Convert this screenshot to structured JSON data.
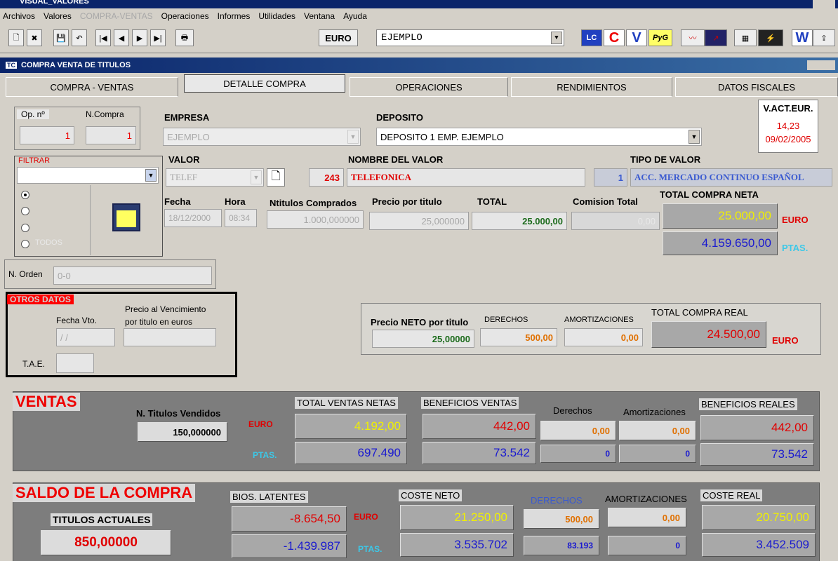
{
  "window": {
    "title": "VISUAL_VALORES"
  },
  "menu": [
    "Archivos",
    "Valores",
    "COMPRA-VENTAS",
    "Operaciones",
    "Informes",
    "Utilidades",
    "Ventana",
    "Ayuda"
  ],
  "toolbar": {
    "currency_button": "EURO",
    "company_select": "EJEMPLO",
    "icon_c": "C",
    "icon_v": "V",
    "icon_pyg": "PyG",
    "icon_w": "W"
  },
  "inner_window": {
    "title": "COMPRA VENTA DE TITULOS"
  },
  "tabs": [
    "COMPRA - VENTAS",
    "DETALLE COMPRA",
    "OPERACIONES",
    "RENDIMIENTOS",
    "DATOS FISCALES"
  ],
  "header": {
    "op_label": "Op. nº",
    "op_value": "1",
    "ncompra_label": "N.Compra",
    "ncompra_value": "1",
    "empresa_label": "EMPRESA",
    "empresa_value": "EJEMPLO",
    "deposito_label": "DEPOSITO",
    "deposito_value": "DEPOSITO 1 EMP. EJEMPLO",
    "vact_label": "V.ACT.EUR.",
    "vact_value": "14,23",
    "vact_date": "09/02/2005"
  },
  "filter": {
    "label": "FILTRAR",
    "option4": "TODOS"
  },
  "valor": {
    "label": "VALOR",
    "value": "TELEF",
    "nombre_label": "NOMBRE DEL VALOR",
    "code": "243",
    "nombre_value": "TELEFONICA",
    "tipo_label": "TIPO DE VALOR",
    "tipo_code": "1",
    "tipo_value": "ACC. MERCADO CONTINUO ESPAÑOL"
  },
  "compra": {
    "fecha_label": "Fecha",
    "fecha_value": "18/12/2000",
    "hora_label": "Hora",
    "hora_value": "08:34",
    "titulos_label": "Ntitulos Comprados",
    "titulos_value": "1.000,000000",
    "precio_label": "Precio por titulo",
    "precio_value": "25,000000",
    "total_label": "TOTAL",
    "total_value": "25.000,00",
    "comision_label": "Comision Total",
    "comision_value": "0,00",
    "neta_label": "TOTAL COMPRA NETA",
    "neta_euro": "25.000,00",
    "neta_ptas": "4.159.650,00",
    "euro_unit": "EURO",
    "ptas_unit": "PTAS."
  },
  "orden": {
    "label": "N. Orden",
    "value": "0-0"
  },
  "otros": {
    "title": "OTROS DATOS",
    "fecha_vto_label": "Fecha Vto.",
    "fecha_vto_value": "/ /",
    "precio_vto_label1": "Precio al Vencimiento",
    "precio_vto_label2": "por titulo en euros",
    "tae_label": "T.A.E."
  },
  "real": {
    "neto_label": "Precio NETO por titulo",
    "neto_value": "25,00000",
    "derechos_label": "DERECHOS",
    "derechos_value": "500,00",
    "amort_label": "AMORTIZACIONES",
    "amort_value": "0,00",
    "total_label": "TOTAL COMPRA REAL",
    "total_value": "24.500,00",
    "unit": "EURO"
  },
  "ventas": {
    "title": "VENTAS",
    "vendidos_label": "N. Titulos Vendidos",
    "vendidos_value": "150,000000",
    "euro": "EURO",
    "ptas": "PTAS.",
    "netas_label": "TOTAL VENTAS NETAS",
    "netas_euro": "4.192,00",
    "netas_ptas": "697.490",
    "benef_label": "BENEFICIOS VENTAS",
    "benef_euro": "442,00",
    "benef_ptas": "73.542",
    "derechos_label": "Derechos",
    "derechos_euro": "0,00",
    "derechos_ptas": "0",
    "amort_label": "Amortizaciones",
    "amort_euro": "0,00",
    "amort_ptas": "0",
    "reales_label": "BENEFICIOS REALES",
    "reales_euro": "442,00",
    "reales_ptas": "73.542"
  },
  "saldo": {
    "title": "SALDO DE LA COMPRA",
    "titulos_label": "TITULOS ACTUALES",
    "titulos_value": "850,00000",
    "latentes_label": "BIOS. LATENTES",
    "latentes_euro": "-8.654,50",
    "latentes_ptas": "-1.439.987",
    "euro": "EURO",
    "ptas": "PTAS.",
    "coste_label": "COSTE NETO",
    "coste_euro": "21.250,00",
    "coste_ptas": "3.535.702",
    "derechos_label": "DERECHOS",
    "derechos_euro": "500,00",
    "derechos_ptas": "83.193",
    "amort_label": "AMORTIZACIONES",
    "amort_euro": "0,00",
    "amort_ptas": "0",
    "real_label": "COSTE REAL",
    "real_euro": "20.750,00",
    "real_ptas": "3.452.509"
  }
}
